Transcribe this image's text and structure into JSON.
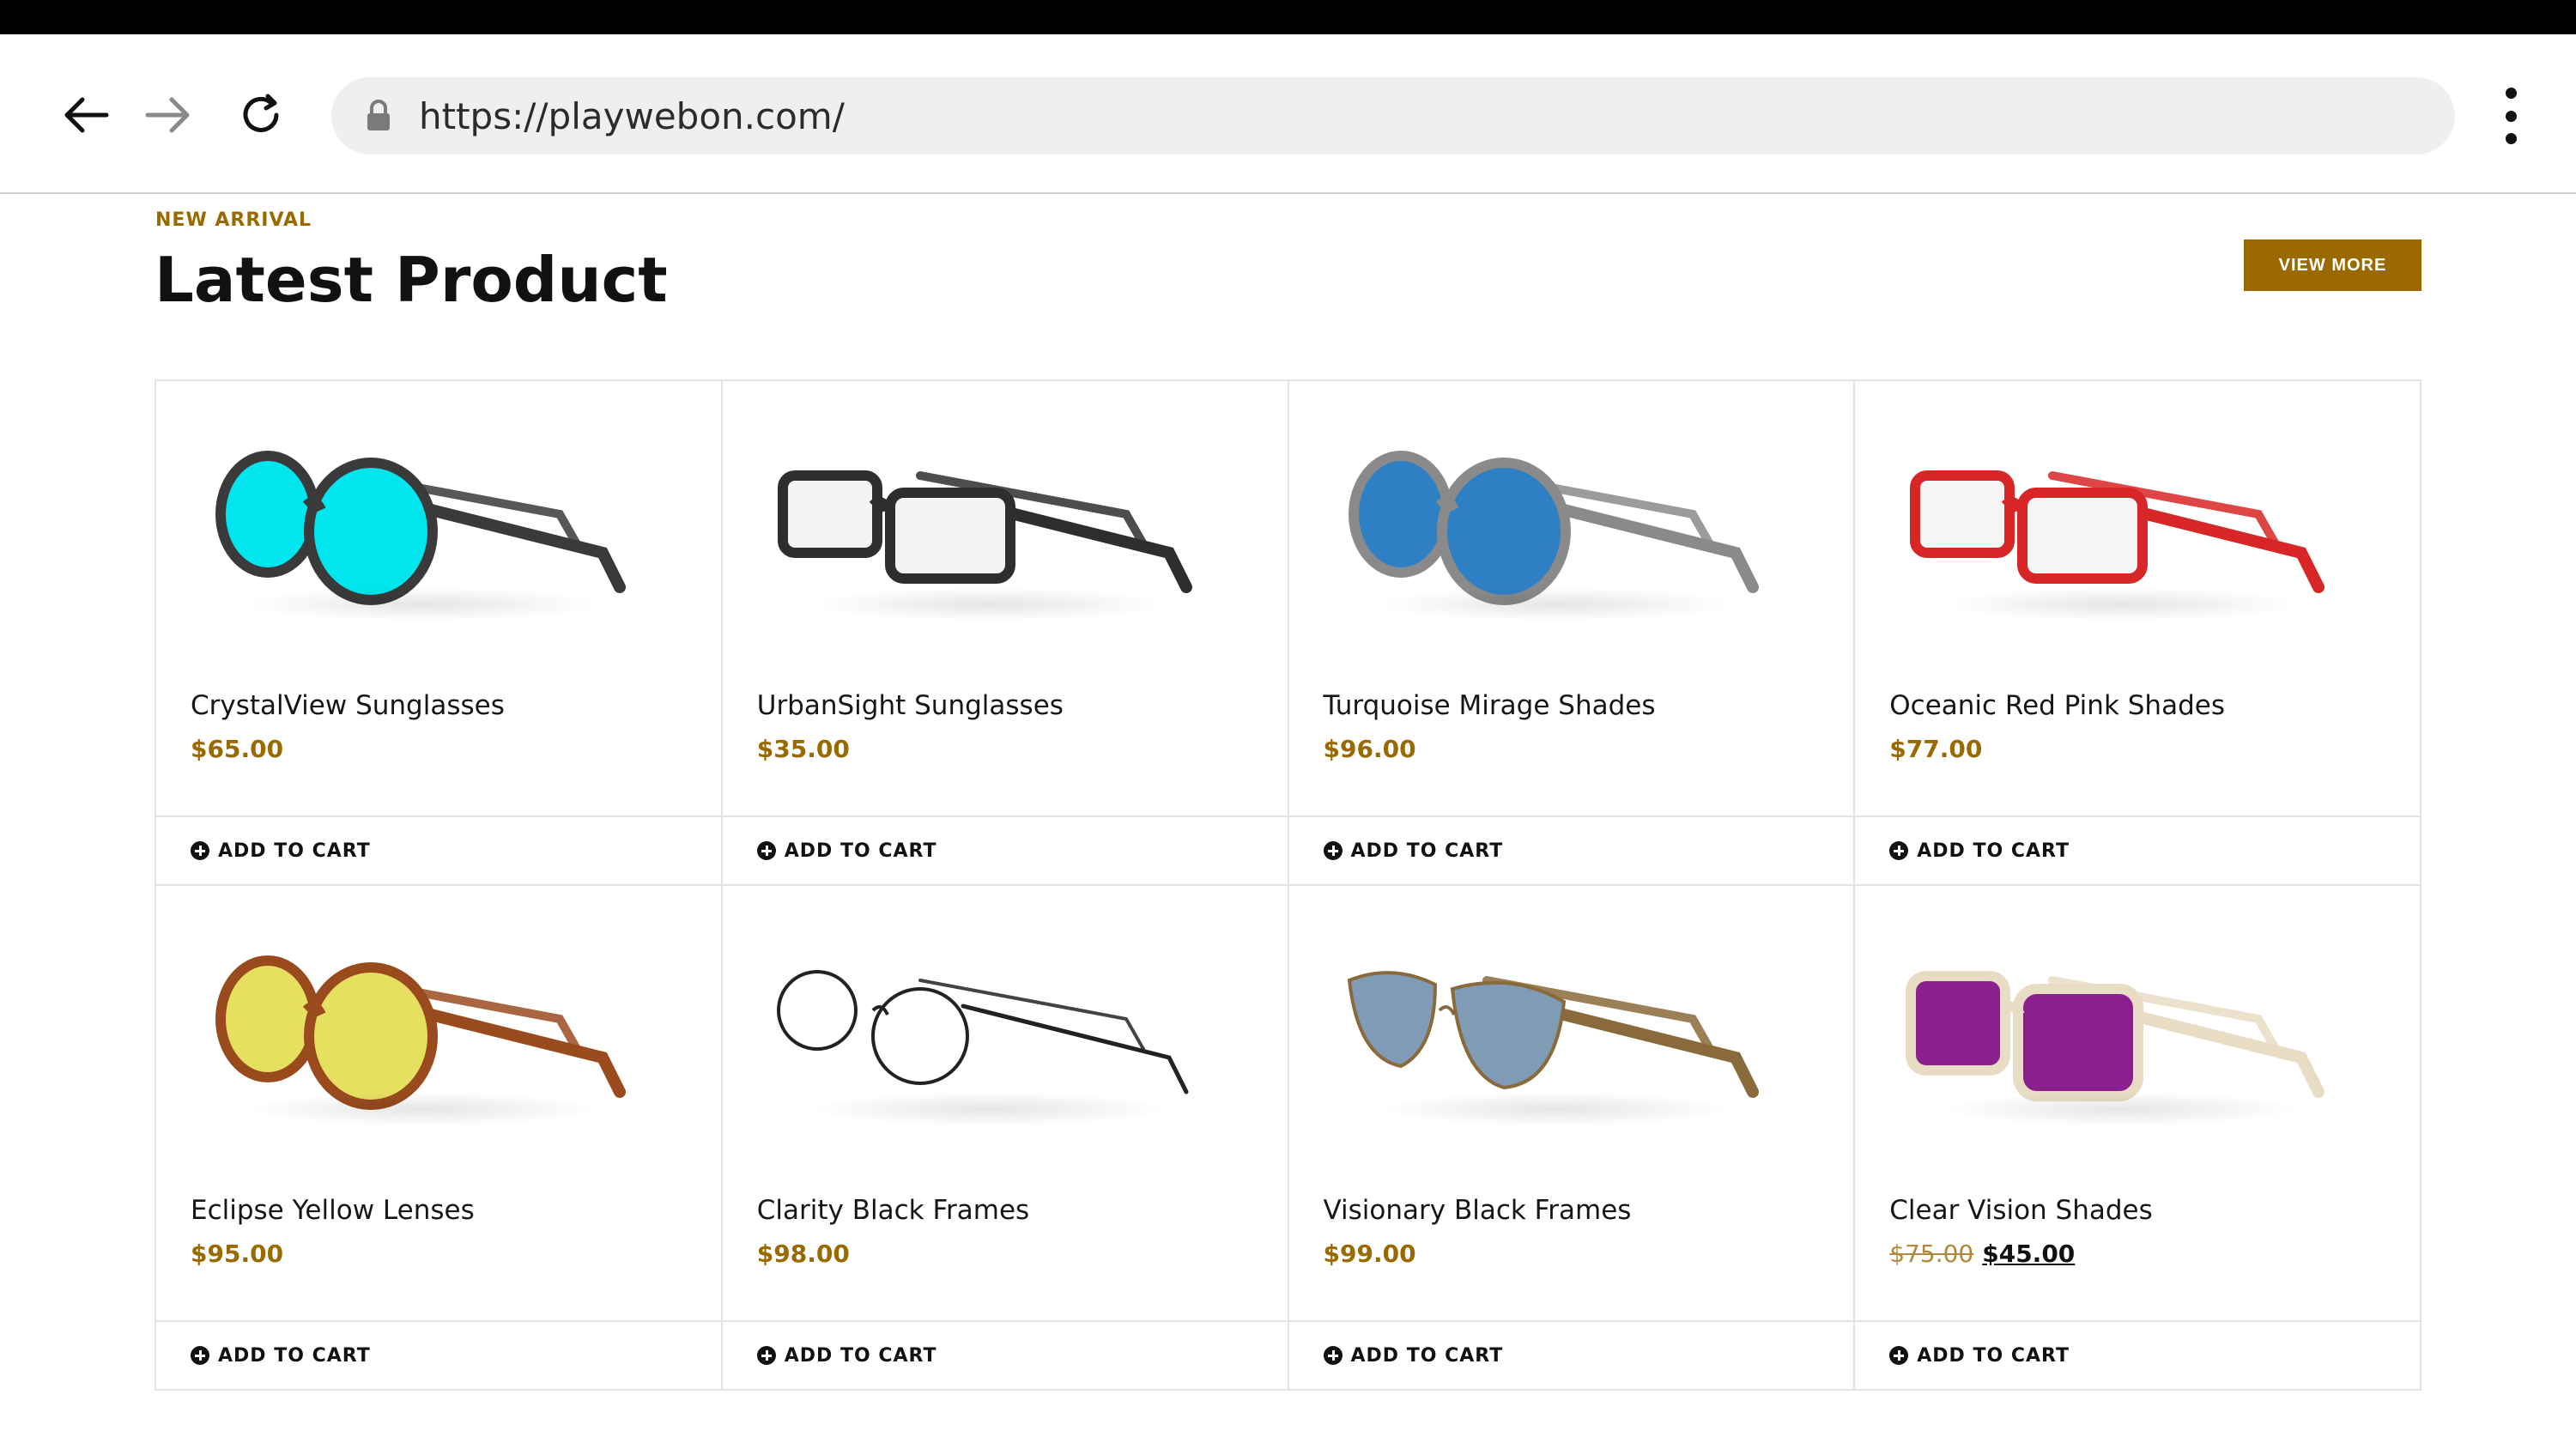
{
  "browser": {
    "url": "https://playwebon.com/"
  },
  "section": {
    "eyebrow": "NEW ARRIVAL",
    "title": "Latest Product",
    "view_more": "VIEW MORE"
  },
  "cart_label": "ADD TO CART",
  "colors": {
    "accent": "#9a6a00",
    "border": "#e3e3e3"
  },
  "products": [
    {
      "name": "CrystalView Sunglasses",
      "price": "$65.00",
      "frame": "#3a3a3a",
      "lens": "#00e5ee"
    },
    {
      "name": "UrbanSight Sunglasses",
      "price": "$35.00",
      "frame": "#2e2e2e",
      "lens": "#f3f3f3"
    },
    {
      "name": "Turquoise Mirage Shades",
      "price": "$96.00",
      "frame": "#8a8a8a",
      "lens": "#2f7fc4"
    },
    {
      "name": "Oceanic Red Pink Shades",
      "price": "$77.00",
      "frame": "#d82626",
      "lens": "#f5f5f5"
    },
    {
      "name": "Eclipse Yellow Lenses",
      "price": "$95.00",
      "frame": "#9a4b1e",
      "lens": "#e6e060"
    },
    {
      "name": "Clarity Black Frames",
      "price": "$98.00",
      "frame": "#222222",
      "lens": "#ffffff"
    },
    {
      "name": "Visionary Black Frames",
      "price": "$99.00",
      "frame": "#8a6a3a",
      "lens": "#7f9bb5"
    },
    {
      "name": "Clear Vision Shades",
      "old_price": "$75.00",
      "price": "$45.00",
      "frame": "#e8dcc4",
      "lens": "#8a1f8e"
    }
  ]
}
